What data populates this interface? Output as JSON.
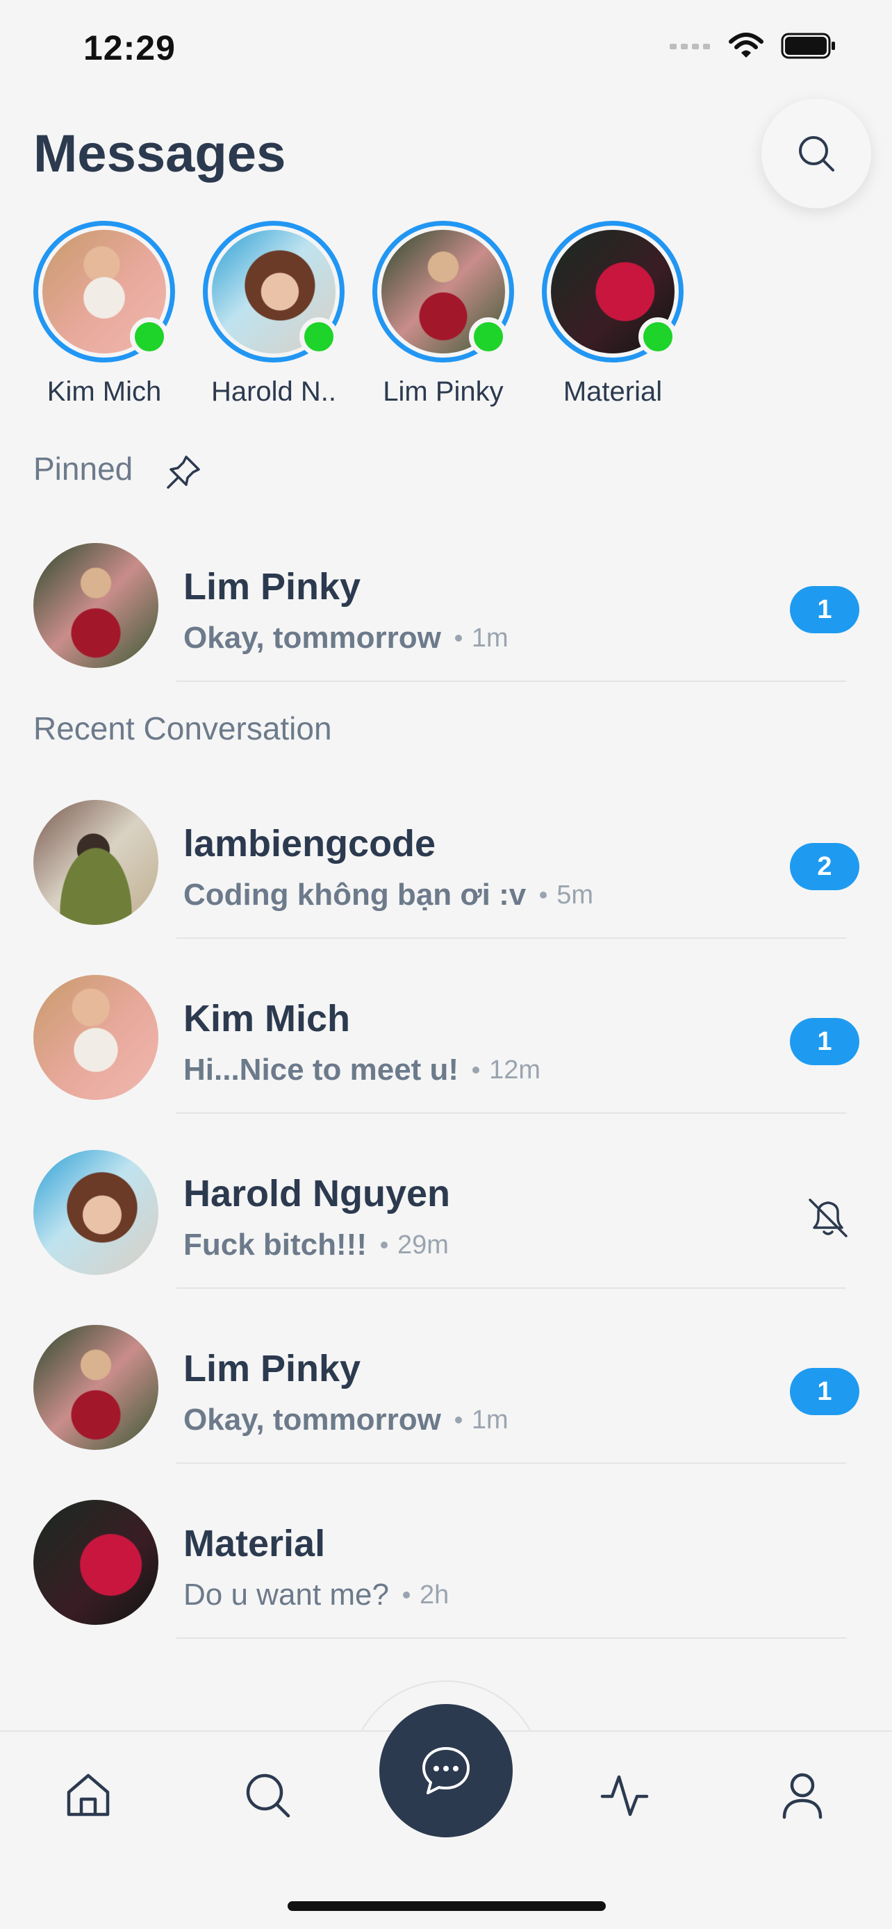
{
  "status_bar": {
    "time": "12:29"
  },
  "header": {
    "title": "Messages"
  },
  "stories": [
    {
      "name": "Kim Mich"
    },
    {
      "name": "Harold N.."
    },
    {
      "name": "Lim Pinky"
    },
    {
      "name": "Material"
    }
  ],
  "sections": {
    "pinned": "Pinned",
    "recent": "Recent Conversation"
  },
  "pinned": [
    {
      "name": "Lim Pinky",
      "preview": "Okay, tommorrow",
      "time": "1m",
      "badge": "1"
    }
  ],
  "recent": [
    {
      "name": "lambiengcode",
      "preview": "Coding không bạn ơi :v",
      "time": "5m",
      "badge": "2"
    },
    {
      "name": "Kim Mich",
      "preview": "Hi...Nice to meet u!",
      "time": "12m",
      "badge": "1"
    },
    {
      "name": "Harold Nguyen",
      "preview": "Fuck bitch!!!",
      "time": "29m",
      "muted": true
    },
    {
      "name": "Lim Pinky",
      "preview": "Okay, tommorrow",
      "time": "1m",
      "badge": "1"
    },
    {
      "name": "Material",
      "preview": "Do u want me?",
      "time": "2h"
    }
  ],
  "colors": {
    "accent": "#1e9bf0",
    "online": "#1ed32a",
    "primary_text": "#2c3a4f",
    "secondary_text": "#6c7a8b"
  },
  "icons": {
    "search": "search-icon",
    "pin": "pin-icon",
    "mute": "bell-off-icon",
    "nav": [
      "home-icon",
      "search-icon",
      "chat-bubble-icon",
      "activity-icon",
      "user-icon"
    ]
  }
}
